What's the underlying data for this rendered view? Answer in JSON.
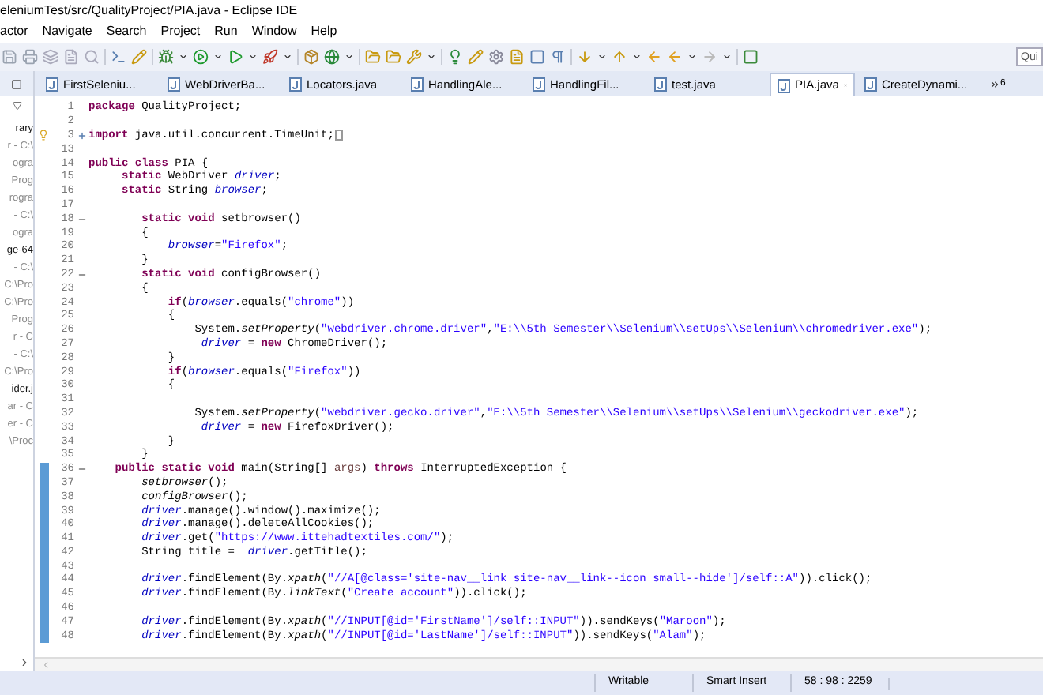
{
  "window": {
    "title": "eleniumTest/src/QualityProject/PIA.java - Eclipse IDE"
  },
  "menu": [
    "actor",
    "Navigate",
    "Search",
    "Project",
    "Run",
    "Window",
    "Help"
  ],
  "quick_access": {
    "placeholder": "Qui"
  },
  "tabs": [
    {
      "label": "FirstSeleniu...",
      "selected": false
    },
    {
      "label": "WebDriverBa...",
      "selected": false
    },
    {
      "label": "Locators.java",
      "selected": false
    },
    {
      "label": "HandlingAle...",
      "selected": false
    },
    {
      "label": "HandlingFil...",
      "selected": false
    },
    {
      "label": "test.java",
      "selected": false
    },
    {
      "label": "PIA.java",
      "selected": true
    },
    {
      "label": "CreateDynami...",
      "selected": false
    }
  ],
  "tabs_overflow": "6",
  "sidebar": {
    "items": [
      {
        "label": "rary",
        "dim": false
      },
      {
        "label": "r - C:\\",
        "dim": true
      },
      {
        "label": "ogra",
        "dim": true
      },
      {
        "label": "Prog",
        "dim": true
      },
      {
        "label": "rogra",
        "dim": true
      },
      {
        "label": "- C:\\",
        "dim": true
      },
      {
        "label": "ogra",
        "dim": true
      },
      {
        "label": "ge-64",
        "dim": false
      },
      {
        "label": "- C:\\",
        "dim": true
      },
      {
        "label": "C:\\Pro",
        "dim": true
      },
      {
        "label": "C:\\Pro",
        "dim": true
      },
      {
        "label": "Prog",
        "dim": true
      },
      {
        "label": "r - C",
        "dim": true
      },
      {
        "label": "- C:\\",
        "dim": true
      },
      {
        "label": "C:\\Pro",
        "dim": true
      },
      {
        "label": "ider.j",
        "dim": false
      },
      {
        "label": "ar - C",
        "dim": true
      },
      {
        "label": "er - C",
        "dim": true
      },
      {
        "label": "\\Proc",
        "dim": true
      }
    ]
  },
  "editor": {
    "lines": [
      {
        "number": "1",
        "kind": "plain",
        "changed": false,
        "annotated": false,
        "tokens": [
          {
            "kind": "keyword",
            "text": "package"
          },
          {
            "kind": "plain",
            "text": " QualityProject;"
          }
        ]
      },
      {
        "number": "2",
        "kind": "plain",
        "changed": false,
        "annotated": false
      },
      {
        "number": "3",
        "kind": "folded",
        "changed": false,
        "annotated": true,
        "tokens": [
          {
            "kind": "keyword",
            "text": "import"
          },
          {
            "kind": "plain",
            "text": " java.util.concurrent.TimeUnit;"
          }
        ]
      },
      {
        "number": "13",
        "kind": "plain",
        "changed": false,
        "annotated": false
      },
      {
        "number": "14",
        "kind": "plain",
        "changed": false,
        "annotated": false,
        "tokens": [
          {
            "kind": "keyword",
            "text": "public class"
          },
          {
            "kind": "plain",
            "text": " PIA {"
          }
        ]
      },
      {
        "number": "15",
        "kind": "plain",
        "changed": false,
        "annotated": false,
        "tokens": [
          {
            "kind": "keyword",
            "text": "     static"
          },
          {
            "kind": "plain",
            "text": " WebDriver "
          },
          {
            "kind": "field",
            "text": "driver"
          },
          {
            "kind": "plain",
            "text": ";"
          }
        ]
      },
      {
        "number": "16",
        "kind": "plain",
        "changed": false,
        "annotated": false,
        "tokens": [
          {
            "kind": "keyword",
            "text": "     static"
          },
          {
            "kind": "plain",
            "text": " String "
          },
          {
            "kind": "field",
            "text": "browser"
          },
          {
            "kind": "plain",
            "text": ";"
          }
        ]
      },
      {
        "number": "17",
        "kind": "plain",
        "changed": false,
        "annotated": false
      },
      {
        "number": "18",
        "kind": "fold_start",
        "changed": false,
        "annotated": false,
        "tokens": [
          {
            "kind": "keyword",
            "text": "        static void"
          },
          {
            "kind": "plain",
            "text": " setbrowser()"
          }
        ]
      },
      {
        "number": "19",
        "kind": "plain",
        "changed": false,
        "annotated": false,
        "tokens": [
          {
            "kind": "plain",
            "text": "        {"
          }
        ]
      },
      {
        "number": "20",
        "kind": "plain",
        "changed": false,
        "annotated": false,
        "tokens": [
          {
            "kind": "field",
            "text": "            browser"
          },
          {
            "kind": "plain",
            "text": "="
          },
          {
            "kind": "string",
            "text": "\"Firefox\""
          },
          {
            "kind": "plain",
            "text": ";"
          }
        ]
      },
      {
        "number": "21",
        "kind": "plain",
        "changed": false,
        "annotated": false,
        "tokens": [
          {
            "kind": "plain",
            "text": "        }"
          }
        ]
      },
      {
        "number": "22",
        "kind": "fold_start",
        "changed": false,
        "annotated": false,
        "tokens": [
          {
            "kind": "keyword",
            "text": "        static void"
          },
          {
            "kind": "plain",
            "text": " configBrowser()"
          }
        ]
      },
      {
        "number": "23",
        "kind": "plain",
        "changed": false,
        "annotated": false,
        "tokens": [
          {
            "kind": "plain",
            "text": "        {"
          }
        ]
      },
      {
        "number": "24",
        "kind": "plain",
        "changed": false,
        "annotated": false,
        "tokens": [
          {
            "kind": "keyword",
            "text": "            if"
          },
          {
            "kind": "plain",
            "text": "("
          },
          {
            "kind": "field",
            "text": "browser"
          },
          {
            "kind": "plain",
            "text": ".equals("
          },
          {
            "kind": "string",
            "text": "\"chrome\""
          },
          {
            "kind": "plain",
            "text": "))"
          }
        ]
      },
      {
        "number": "25",
        "kind": "plain",
        "changed": false,
        "annotated": false,
        "tokens": [
          {
            "kind": "plain",
            "text": "            {"
          }
        ]
      },
      {
        "number": "26",
        "kind": "plain",
        "changed": false,
        "annotated": false,
        "tokens": [
          {
            "kind": "plain",
            "text": "                System."
          },
          {
            "kind": "static",
            "text": "setProperty"
          },
          {
            "kind": "plain",
            "text": "("
          },
          {
            "kind": "string",
            "text": "\"webdriver.chrome.driver\""
          },
          {
            "kind": "plain",
            "text": ","
          },
          {
            "kind": "string",
            "text": "\"E:\\\\5th Semester\\\\Selenium\\\\setUps\\\\Selenium\\\\chromedriver.exe\""
          },
          {
            "kind": "plain",
            "text": ");"
          }
        ]
      },
      {
        "number": "27",
        "kind": "plain",
        "changed": false,
        "annotated": false,
        "tokens": [
          {
            "kind": "field",
            "text": "                 driver"
          },
          {
            "kind": "plain",
            "text": " = "
          },
          {
            "kind": "keyword",
            "text": "new"
          },
          {
            "kind": "plain",
            "text": " ChromeDriver();"
          }
        ]
      },
      {
        "number": "28",
        "kind": "plain",
        "changed": false,
        "annotated": false,
        "tokens": [
          {
            "kind": "plain",
            "text": "            }"
          }
        ]
      },
      {
        "number": "29",
        "kind": "plain",
        "changed": false,
        "annotated": false,
        "tokens": [
          {
            "kind": "keyword",
            "text": "            if"
          },
          {
            "kind": "plain",
            "text": "("
          },
          {
            "kind": "field",
            "text": "browser"
          },
          {
            "kind": "plain",
            "text": ".equals("
          },
          {
            "kind": "string",
            "text": "\"Firefox\""
          },
          {
            "kind": "plain",
            "text": "))"
          }
        ]
      },
      {
        "number": "30",
        "kind": "plain",
        "changed": false,
        "annotated": false,
        "tokens": [
          {
            "kind": "plain",
            "text": "            {"
          }
        ]
      },
      {
        "number": "31",
        "kind": "plain",
        "changed": false,
        "annotated": false
      },
      {
        "number": "32",
        "kind": "plain",
        "changed": false,
        "annotated": false,
        "tokens": [
          {
            "kind": "plain",
            "text": "                System."
          },
          {
            "kind": "static",
            "text": "setProperty"
          },
          {
            "kind": "plain",
            "text": "("
          },
          {
            "kind": "string",
            "text": "\"webdriver.gecko.driver\""
          },
          {
            "kind": "plain",
            "text": ","
          },
          {
            "kind": "string",
            "text": "\"E:\\\\5th Semester\\\\Selenium\\\\setUps\\\\Selenium\\\\geckodriver.exe\""
          },
          {
            "kind": "plain",
            "text": ");"
          }
        ]
      },
      {
        "number": "33",
        "kind": "plain",
        "changed": false,
        "annotated": false,
        "tokens": [
          {
            "kind": "field",
            "text": "                 driver"
          },
          {
            "kind": "plain",
            "text": " = "
          },
          {
            "kind": "keyword",
            "text": "new"
          },
          {
            "kind": "plain",
            "text": " FirefoxDriver();"
          }
        ]
      },
      {
        "number": "34",
        "kind": "plain",
        "changed": false,
        "annotated": false,
        "tokens": [
          {
            "kind": "plain",
            "text": "            }"
          }
        ]
      },
      {
        "number": "35",
        "kind": "plain",
        "changed": false,
        "annotated": false,
        "tokens": [
          {
            "kind": "plain",
            "text": "        }"
          }
        ]
      },
      {
        "number": "36",
        "kind": "fold_start",
        "changed": true,
        "annotated": false,
        "tokens": [
          {
            "kind": "keyword",
            "text": "    public static void"
          },
          {
            "kind": "plain",
            "text": " main(String[] "
          },
          {
            "kind": "param",
            "text": "args"
          },
          {
            "kind": "plain",
            "text": ") "
          },
          {
            "kind": "keyword",
            "text": "throws"
          },
          {
            "kind": "plain",
            "text": " InterruptedException {"
          }
        ]
      },
      {
        "number": "37",
        "kind": "plain",
        "changed": true,
        "annotated": false,
        "tokens": [
          {
            "kind": "call",
            "text": "        setbrowser"
          },
          {
            "kind": "plain",
            "text": "();"
          }
        ]
      },
      {
        "number": "38",
        "kind": "plain",
        "changed": true,
        "annotated": false,
        "tokens": [
          {
            "kind": "call",
            "text": "        configBrowser"
          },
          {
            "kind": "plain",
            "text": "();"
          }
        ]
      },
      {
        "number": "39",
        "kind": "plain",
        "changed": true,
        "annotated": false,
        "tokens": [
          {
            "kind": "field",
            "text": "        driver"
          },
          {
            "kind": "plain",
            "text": ".manage().window().maximize();"
          }
        ]
      },
      {
        "number": "40",
        "kind": "plain",
        "changed": true,
        "annotated": false,
        "tokens": [
          {
            "kind": "field",
            "text": "        driver"
          },
          {
            "kind": "plain",
            "text": ".manage().deleteAllCookies();"
          }
        ]
      },
      {
        "number": "41",
        "kind": "plain",
        "changed": true,
        "annotated": false,
        "tokens": [
          {
            "kind": "field",
            "text": "        driver"
          },
          {
            "kind": "plain",
            "text": ".get("
          },
          {
            "kind": "string",
            "text": "\"https://www.ittehadtextiles.com/\""
          },
          {
            "kind": "plain",
            "text": ");"
          }
        ]
      },
      {
        "number": "42",
        "kind": "plain",
        "changed": true,
        "annotated": false,
        "tokens": [
          {
            "kind": "plain",
            "text": "        String title =  "
          },
          {
            "kind": "field",
            "text": "driver"
          },
          {
            "kind": "plain",
            "text": ".getTitle();"
          }
        ]
      },
      {
        "number": "43",
        "kind": "plain",
        "changed": true,
        "annotated": false
      },
      {
        "number": "44",
        "kind": "plain",
        "changed": true,
        "annotated": false,
        "tokens": [
          {
            "kind": "field",
            "text": "        driver"
          },
          {
            "kind": "plain",
            "text": ".findElement(By."
          },
          {
            "kind": "static",
            "text": "xpath"
          },
          {
            "kind": "plain",
            "text": "("
          },
          {
            "kind": "string",
            "text": "\"//A[@class='site-nav__link site-nav__link--icon small--hide']/self::A\""
          },
          {
            "kind": "plain",
            "text": ")).click();"
          }
        ]
      },
      {
        "number": "45",
        "kind": "plain",
        "changed": true,
        "annotated": false,
        "tokens": [
          {
            "kind": "field",
            "text": "        driver"
          },
          {
            "kind": "plain",
            "text": ".findElement(By."
          },
          {
            "kind": "static",
            "text": "linkText"
          },
          {
            "kind": "plain",
            "text": "("
          },
          {
            "kind": "string",
            "text": "\"Create account\""
          },
          {
            "kind": "plain",
            "text": ")).click();"
          }
        ]
      },
      {
        "number": "46",
        "kind": "plain",
        "changed": true,
        "annotated": false
      },
      {
        "number": "47",
        "kind": "plain",
        "changed": true,
        "annotated": false,
        "tokens": [
          {
            "kind": "field",
            "text": "        driver"
          },
          {
            "kind": "plain",
            "text": ".findElement(By."
          },
          {
            "kind": "static",
            "text": "xpath"
          },
          {
            "kind": "plain",
            "text": "("
          },
          {
            "kind": "string",
            "text": "\"//INPUT[@id='FirstName']/self::INPUT\""
          },
          {
            "kind": "plain",
            "text": ")).sendKeys("
          },
          {
            "kind": "string",
            "text": "\"Maroon\""
          },
          {
            "kind": "plain",
            "text": ");"
          }
        ]
      },
      {
        "number": "48",
        "kind": "plain",
        "changed": true,
        "annotated": false,
        "tokens": [
          {
            "kind": "field",
            "text": "        driver"
          },
          {
            "kind": "plain",
            "text": ".findElement(By."
          },
          {
            "kind": "static",
            "text": "xpath"
          },
          {
            "kind": "plain",
            "text": "("
          },
          {
            "kind": "string",
            "text": "\"//INPUT[@id='LastName']/self::INPUT\""
          },
          {
            "kind": "plain",
            "text": ")).sendKeys("
          },
          {
            "kind": "string",
            "text": "\"Alam\""
          },
          {
            "kind": "plain",
            "text": ");"
          }
        ]
      }
    ]
  },
  "status_bar": [
    "Writable",
    "Smart Insert",
    "58 : 98 : 2259"
  ]
}
